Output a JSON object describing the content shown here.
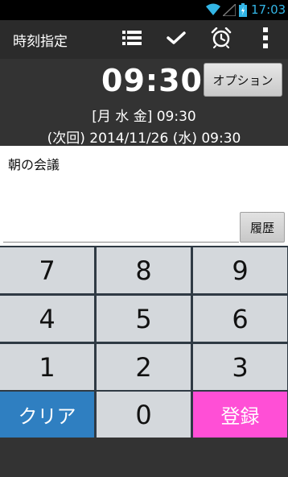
{
  "status_bar": {
    "time": "17:03",
    "icons": [
      "wifi-icon",
      "signal-icon",
      "battery-icon"
    ],
    "accent_color": "#33b5e5"
  },
  "action_bar": {
    "title": "時刻指定",
    "actions": [
      "list-icon",
      "check-icon",
      "alarm-clock-icon",
      "overflow-menu-icon"
    ]
  },
  "alarm": {
    "time": "09:30",
    "days": "[月 水 金] 09:30",
    "next": "(次回) 2014/11/26 (水) 09:30",
    "option_label": "オプション"
  },
  "memo": {
    "value": "朝の会議",
    "history_label": "履歴"
  },
  "keypad": {
    "keys": [
      "7",
      "8",
      "9",
      "4",
      "5",
      "6",
      "1",
      "2",
      "3"
    ],
    "clear_label": "クリア",
    "zero_label": "0",
    "register_label": "登録",
    "clear_color": "#2f7fc1",
    "register_color": "#ff4fd6"
  }
}
